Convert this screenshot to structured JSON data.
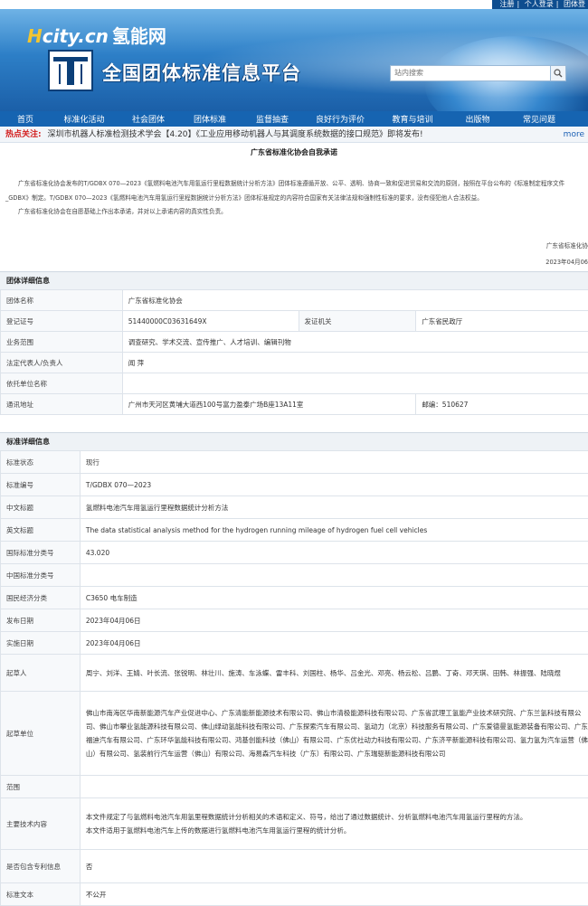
{
  "top_links": [
    "注册",
    "个人登录",
    "团体登"
  ],
  "banner": {
    "logo_h": "H",
    "logo_rest": "city.cn",
    "logo_cn": "氢能网",
    "platform_title": "全国团体标准信息平台"
  },
  "search": {
    "placeholder": "站内搜索"
  },
  "nav": [
    "首页",
    "标准化活动",
    "社会团体",
    "团体标准",
    "监督抽查",
    "良好行为评价",
    "教育与培训",
    "出版物",
    "常见问题"
  ],
  "hot": {
    "label": "热点关注:",
    "text": "深圳市机器人标准检测技术学会【4.20】《工业应用移动机器人与其调度系统数据的接口规范》即将发布!",
    "more": "more"
  },
  "pledge": {
    "title": "广东省标准化协会自我承诺",
    "para1": "广东省标准化协会发布的T/GDBX 070—2023《氢燃料电池汽车用氢运行里程数据统计分析方法》团体标准遵循开放、公平、透明、协商一致和促进贸易和交流的原则，按照在平台公布的《标准制定程序文件_GDBX》制定。T/GDBX 070—2023《氢燃料电池汽车用氢运行里程数据统计分析方法》团体标准规定的内容符合国家有关法律法规和强制性标准的要求，没有侵犯他人合法权益。",
    "para2": "广东省标准化协会在自愿基础上作出本承诺，并对以上承诺内容的真实性负责。",
    "signer": "广东省标准化协",
    "date": "2023年04月06"
  },
  "group": {
    "heading": "团体详细信息",
    "name_label": "团体名称",
    "name": "广东省标准化协会",
    "reg_label": "登记证号",
    "reg": "51440000C03631649X",
    "authority_label": "发证机关",
    "authority": "广东省民政厅",
    "scope_label": "业务范围",
    "scope": "调查研究、学术交流、宣传推广、人才培训、编辑刊物",
    "rep_label": "法定代表人/负责人",
    "rep": "闻 萍",
    "unit_label": "依托单位名称",
    "unit": "",
    "addr_label": "通讯地址",
    "addr": "广州市天河区黄埔大道西100号富力盈泰广场B座13A11室",
    "zip": "邮编：510627"
  },
  "standard": {
    "heading": "标准详细信息",
    "rows": [
      {
        "k": "标准状态",
        "v": "现行"
      },
      {
        "k": "标准编号",
        "v": "T/GDBX 070—2023"
      },
      {
        "k": "中文标题",
        "v": "氢燃料电池汽车用氢运行里程数据统计分析方法"
      },
      {
        "k": "英文标题",
        "v": "The data statistical analysis method for the hydrogen running mileage of hydrogen fuel cell vehicles"
      },
      {
        "k": "国际标准分类号",
        "v": "43.020"
      },
      {
        "k": "中国标准分类号",
        "v": ""
      },
      {
        "k": "国民经济分类",
        "v": "C3650 电车制造"
      },
      {
        "k": "发布日期",
        "v": "2023年04月06日"
      },
      {
        "k": "实施日期",
        "v": "2023年04月06日"
      },
      {
        "k": "起草人",
        "v": "周宁、刘洋、王婧、叶长流、张锐明、林壮川、施涛、车泳蝶、雷丰科、刘国柱、杨华、吕金光、邓亮、杨云松、吕鹏、丁奇、邓天琪、田韩、林振强、陆晓煜"
      },
      {
        "k": "起草单位",
        "v": "佛山市南海区华南新能源汽车产业促进中心、广东清能新能源技术有限公司、佛山市清极能源科技有限公司、广东省武理工氢能产业技术研究院、广东兰氢科技有限公司、佛山市攀业氢能源科技有限公司、佛山绿动氢能科技有限公司、广东探索汽车有限公司、氢动力（北京）科技服务有限公司、广东爱德曼氢能源装备有限公司、广东福迪汽车有限公司、广东环华氢能科技有限公司、鸿基创能科技（佛山）有限公司、广东优社动力科技有限公司、广东济平新能源科技有限公司、氢力氢为汽车运营（佛山）有限公司、氢装前行汽车运营（佛山）有限公司、海易森汽车科技（广东）有限公司、广东瑞驱新能源科技有限公司"
      },
      {
        "k": "范围",
        "v": ""
      },
      {
        "k": "主要技术内容",
        "v": "本文件规定了与氢燃料电池汽车用氢里程数据统计分析相关的术语和定义、符号，给出了通过数据统计、分析氢燃料电池汽车用氢运行里程的方法。\n本文件适用于氢燃料电池汽车上传的数据进行氢燃料电池汽车用氢运行里程的统计分析。"
      },
      {
        "k": "是否包含专利信息",
        "v": "否"
      },
      {
        "k": "标准文本",
        "v": "不公开"
      }
    ]
  }
}
